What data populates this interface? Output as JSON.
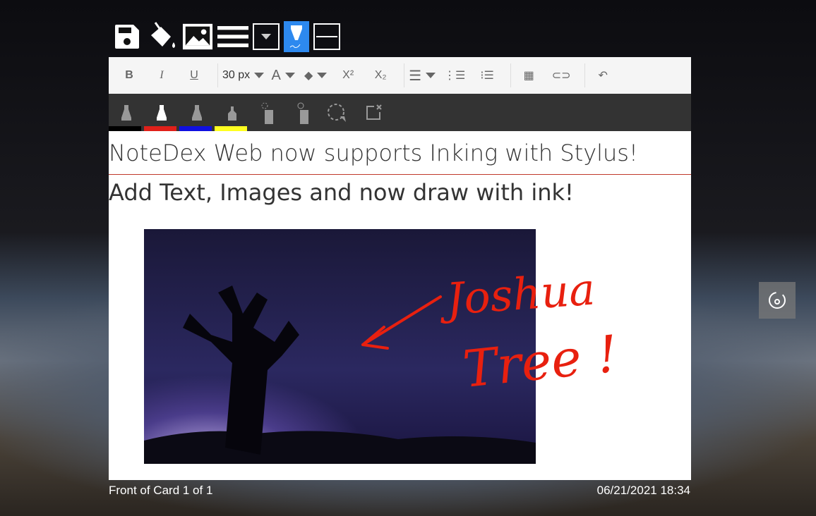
{
  "toolbar_top": {
    "icons": [
      "save-icon",
      "paint-bucket-icon",
      "image-icon",
      "lines-icon",
      "dropdown-icon",
      "stylus-icon",
      "horizontal-line-icon"
    ]
  },
  "editor_toolbar": {
    "font_size": "30 px",
    "font_color_label": "A",
    "superscript": "X²",
    "subscript": "X₂"
  },
  "ink_toolbar": {
    "pen_colors": [
      "#000000",
      "#e0201a",
      "#1010e0",
      "#ffff20"
    ]
  },
  "content": {
    "line1": "NoteDex Web now supports Inking with Stylus!",
    "line2": "Add Text, Images and now draw with ink!",
    "ink_text": [
      "Joshua",
      "Tree !"
    ]
  },
  "footer": {
    "card_label": "Front of Card 1 of 1",
    "timestamp": "06/21/2021 18:34"
  }
}
